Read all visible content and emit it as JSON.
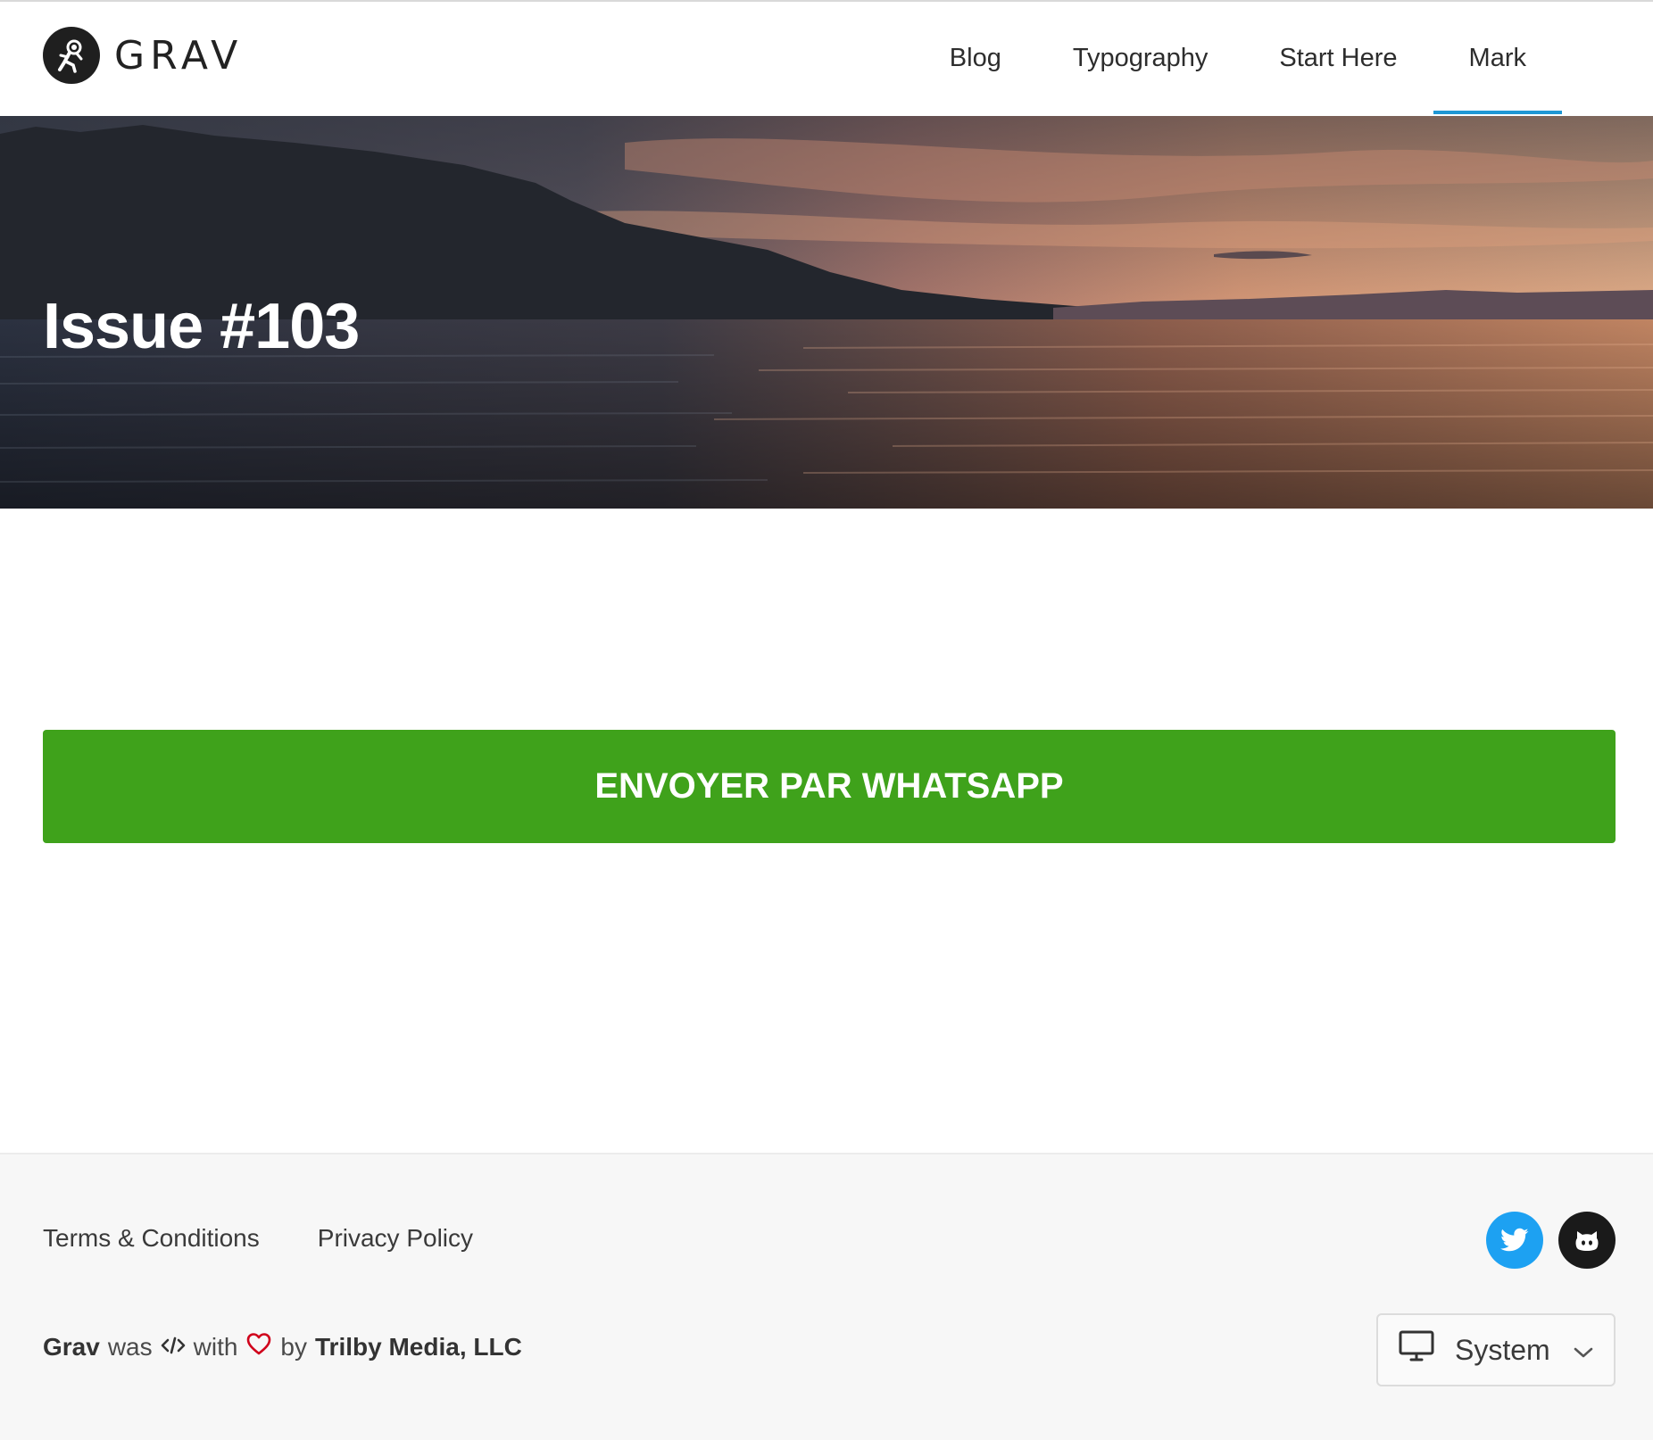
{
  "brand": {
    "name": "GRAV"
  },
  "nav": {
    "items": [
      {
        "label": "Blog",
        "active": false
      },
      {
        "label": "Typography",
        "active": false
      },
      {
        "label": "Start Here",
        "active": false
      },
      {
        "label": "Mark",
        "active": true
      }
    ],
    "active_color": "#1f97d4"
  },
  "hero": {
    "title": "Issue #103"
  },
  "main": {
    "button_label": "ENVOYER PAR WHATSAPP",
    "button_color": "#3fa21b"
  },
  "footer": {
    "links": [
      {
        "label": "Terms & Conditions"
      },
      {
        "label": "Privacy Policy"
      }
    ],
    "social": [
      {
        "name": "twitter-icon",
        "color": "#1da1f2"
      },
      {
        "name": "github-icon",
        "color": "#1a1a1a"
      }
    ],
    "credit": {
      "site": "Grav",
      "was": "was",
      "with": "with",
      "by": "by",
      "company": "Trilby Media, LLC"
    },
    "theme_select": {
      "value": "System"
    }
  }
}
